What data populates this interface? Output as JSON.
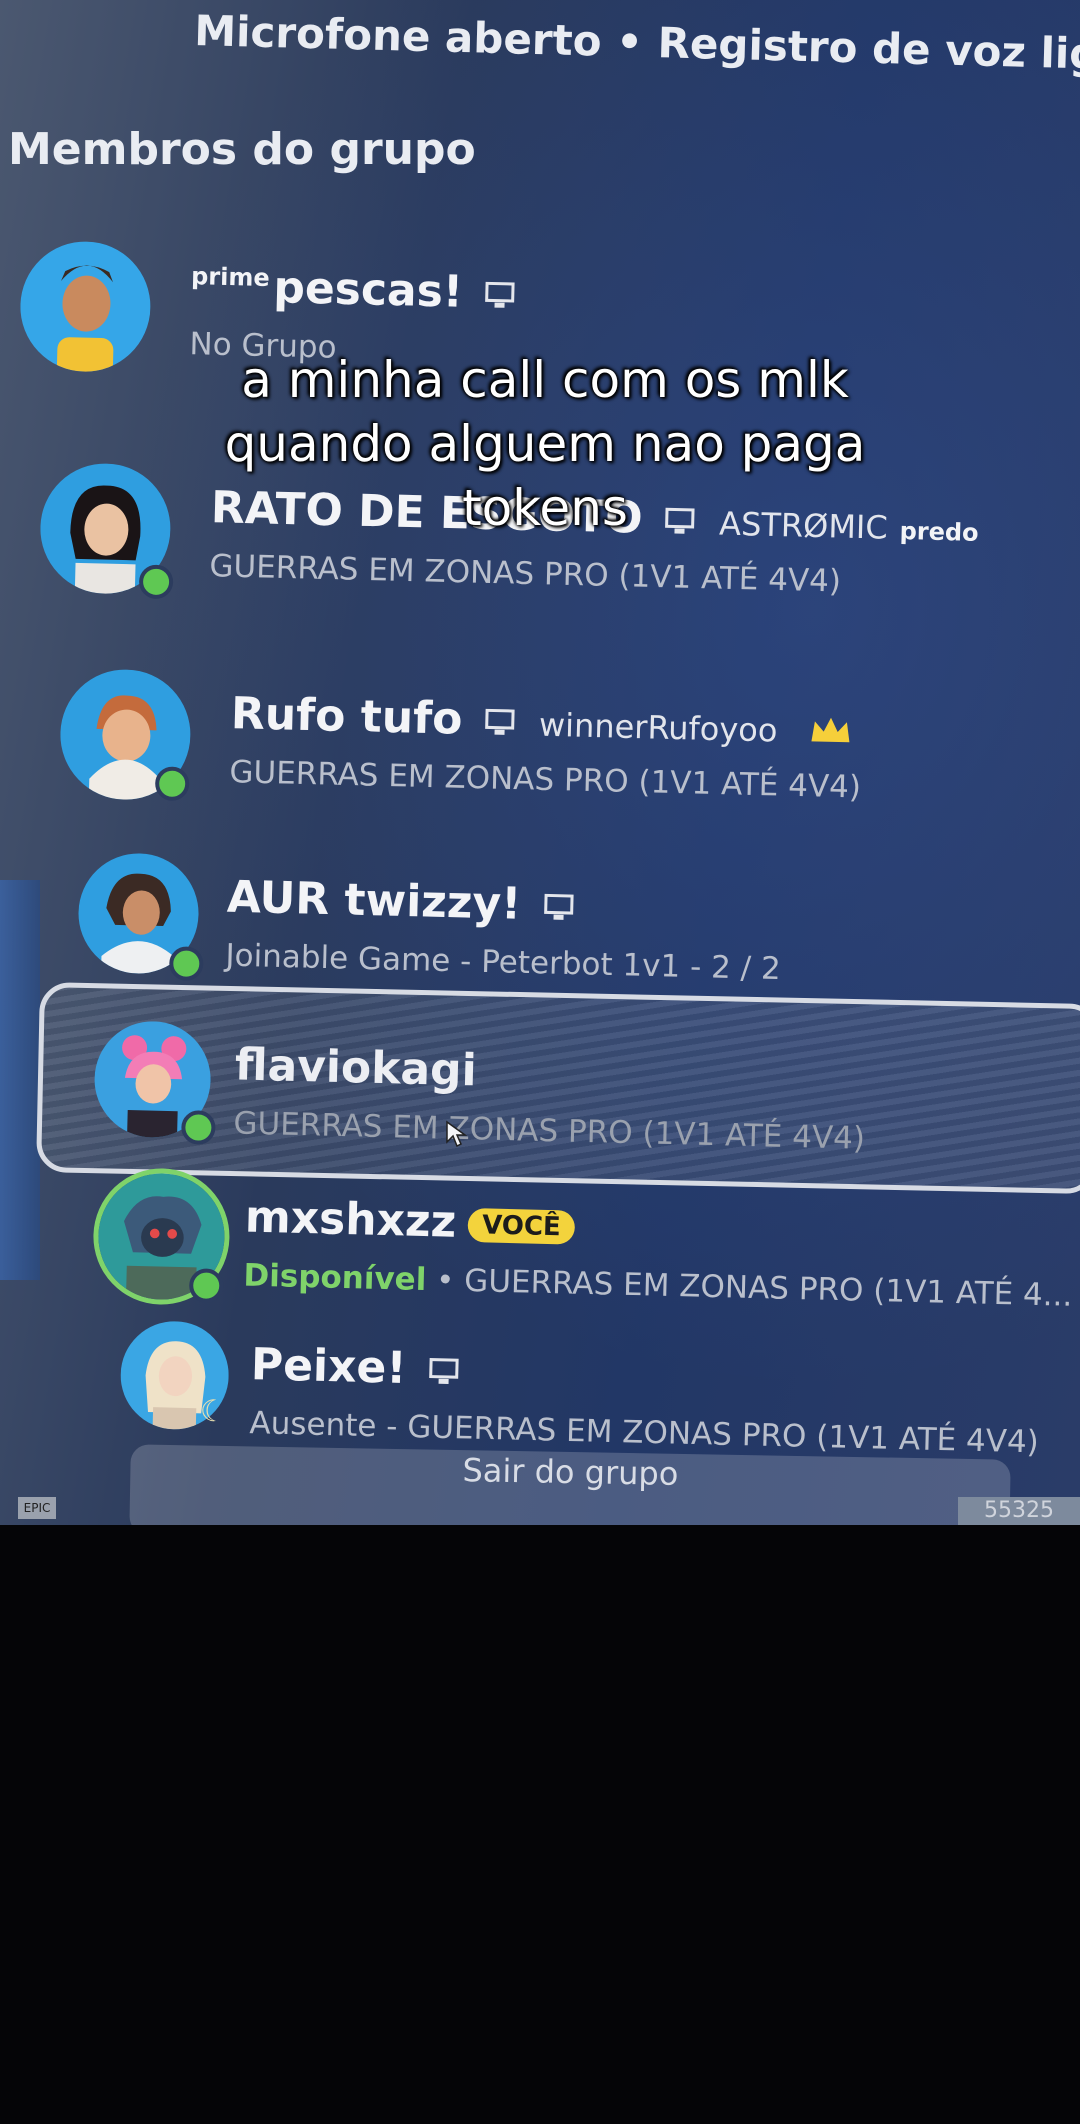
{
  "header": {
    "voice_status": "Microfone aberto • Registro de voz ligado"
  },
  "section": {
    "title": "Membros do grupo"
  },
  "members": [
    {
      "prefix": "prime",
      "name": "pescas!",
      "platform_icon": "pc-icon",
      "status": "No Grupo",
      "online": false
    },
    {
      "name": "RATO DE ESGOTO",
      "platform_icon": "pc-icon",
      "epic_name": "ASTRØMIC",
      "suffix": "predo",
      "status": "GUERRAS EM ZONAS PRO (1V1 ATÉ 4V4)",
      "online": true
    },
    {
      "name": "Rufo tufo",
      "platform_icon": "pc-icon",
      "epic_name": "winnerRufoyoo",
      "leader_icon": "crown-icon",
      "status": "GUERRAS EM ZONAS PRO (1V1 ATÉ 4V4)",
      "online": true
    },
    {
      "name": "AUR twizzy!",
      "platform_icon": "pc-icon",
      "status": "Joinable Game - Peterbot 1v1 - 2 / 2",
      "online": true
    },
    {
      "name": "flaviokagi",
      "status": "GUERRAS EM ZONAS PRO (1V1 ATÉ 4V4)",
      "online": true,
      "selected": true
    },
    {
      "name": "mxshxzz",
      "badge": "VOCÊ",
      "availability": "Disponível",
      "status": "• GUERRAS EM ZONAS PRO (1V1 ATÉ 4...",
      "online": true
    },
    {
      "name": "Peixe!",
      "platform_icon": "pc-icon",
      "status": "Ausente - GUERRAS EM ZONAS PRO (1V1 ATÉ 4V4)",
      "away_icon": "moon-icon"
    }
  ],
  "footer": {
    "leave_button": "Sair do grupo",
    "corner_label": "EPIC",
    "corner_number": "55325"
  },
  "caption": {
    "lines": [
      "a minha call com os mlk",
      "quando alguem nao paga",
      "tokens"
    ]
  },
  "colors": {
    "online": "#5fc853",
    "you_badge": "#f3d33c",
    "available": "#7fd36a"
  }
}
